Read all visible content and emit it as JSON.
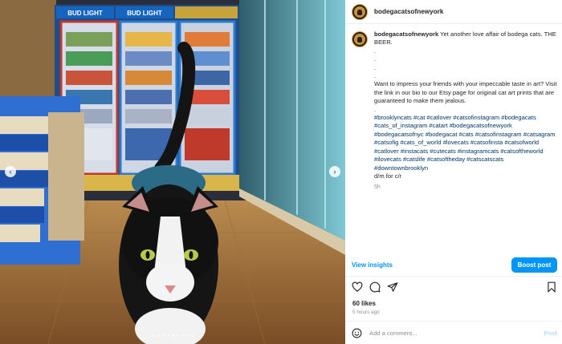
{
  "post": {
    "username": "bodegacatsofnewyork",
    "caption_user": "bodegacatsofnewyork",
    "caption_title": "Yet another love affair of bodega cats. THE BEER.",
    "caption_dots": [
      ".",
      ".",
      ".",
      "."
    ],
    "caption_body": "Want to impress your friends with your impeccable taste in art? Visit the link in our bio to our Etsy page for original cat art prints that are guaranteed to make them jealous.",
    "caption_dot_before_tags": ".",
    "hashtags": "#brooklyncats #cat #catlover #catsofinstagram #bodegacats #cats_of_instagram #catart #bodegacatsofnewyork #bodegacatsofnyc #bodegacat #cats #catsofinstagram #catsagram #catsofig #cats_of_world #lovecats #catsofinsta #catsofworld #catlover #instacats #cutecats #instagramcats #catsoftheworld #ilovecats #catslife #catsoftheday #catscatscats #downtownbrooklyn",
    "signature": "d/m for c/r",
    "caption_time": "5h",
    "view_insights": "View insights",
    "boost_label": "Boost post",
    "likes": "60 likes",
    "time_ago": "5 hours ago",
    "comment_placeholder": "Add a comment...",
    "post_button": "Post"
  },
  "media": {
    "signs": [
      "BUD LIGHT",
      "BUD LIGHT"
    ],
    "prev_glyph": "‹",
    "next_glyph": "›",
    "carousel_count": 9,
    "carousel_active_index": 4
  },
  "icons": {
    "heart": "heart-icon",
    "comment": "comment-icon",
    "share": "share-icon",
    "bookmark": "bookmark-icon",
    "emoji": "emoji-icon"
  },
  "colors": {
    "accent": "#0095f6",
    "hashtag": "#00376b",
    "muted": "#8e8e8e"
  }
}
